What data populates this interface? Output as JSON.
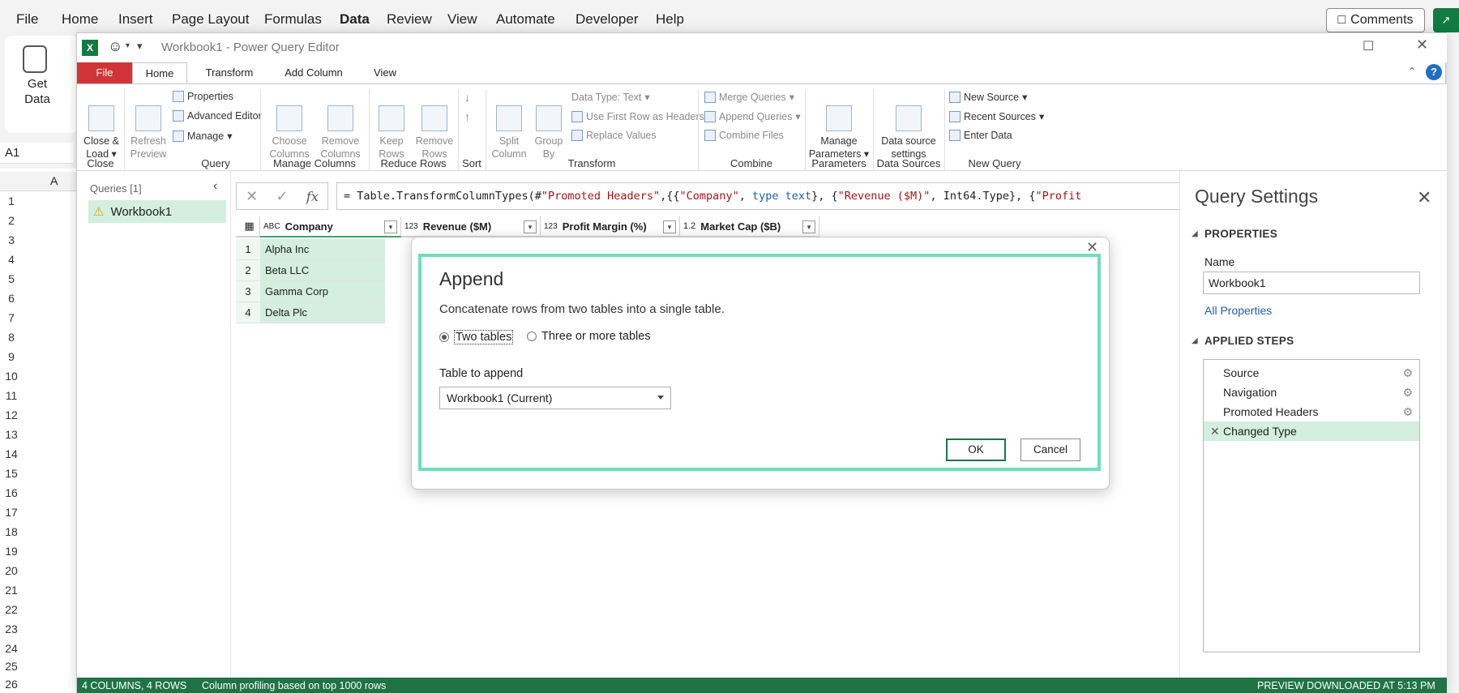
{
  "excel": {
    "menu": [
      "File",
      "Home",
      "Insert",
      "Page Layout",
      "Formulas",
      "Data",
      "Review",
      "View",
      "Automate",
      "Developer",
      "Help"
    ],
    "comments_label": "Comments",
    "get_data_label": "Get\nData",
    "namebox": "A1",
    "col_a": "A",
    "rows": [
      "1",
      "2",
      "3",
      "4",
      "5",
      "6",
      "7",
      "8",
      "9",
      "10",
      "11",
      "12",
      "13",
      "14",
      "15",
      "16",
      "17",
      "18",
      "19",
      "20",
      "21",
      "22",
      "23",
      "24",
      "25",
      "26"
    ]
  },
  "pq": {
    "title": "Workbook1 - Power Query Editor",
    "tabs": [
      "File",
      "Home",
      "Transform",
      "Add Column",
      "View"
    ],
    "ribbon": {
      "close_load": "Close &\nLoad",
      "refresh_preview": "Refresh\nPreview",
      "properties": "Properties",
      "advanced_editor": "Advanced Editor",
      "manage": "Manage",
      "choose_columns": "Choose\nColumns",
      "remove_columns": "Remove\nColumns",
      "keep_rows": "Keep\nRows",
      "remove_rows": "Remove\nRows",
      "split_column": "Split\nColumn",
      "group_by": "Group\nBy",
      "data_type": "Data Type: Text",
      "use_first_row": "Use First Row as Headers",
      "replace_values": "Replace Values",
      "merge_queries": "Merge Queries",
      "append_queries": "Append Queries",
      "combine_files": "Combine Files",
      "manage_parameters": "Manage\nParameters",
      "data_source_settings": "Data source\nsettings",
      "new_source": "New Source",
      "recent_sources": "Recent Sources",
      "enter_data": "Enter Data",
      "groups": [
        "Close",
        "Query",
        "Manage Columns",
        "Reduce Rows",
        "Sort",
        "Transform",
        "Combine",
        "Parameters",
        "Data Sources",
        "New Query"
      ]
    },
    "queries": {
      "header": "Queries [1]",
      "items": [
        "Workbook1"
      ]
    },
    "formula": {
      "prefix": "= Table.TransformColumnTypes(#",
      "s1": "\"Promoted Headers\"",
      "mid1": ",{{",
      "s2": "\"Company\"",
      "mid2": ", ",
      "k1": "type text",
      "mid3": "}, {",
      "s3": "\"Revenue ($M)\"",
      "mid4": ", Int64.Type}, {",
      "s4": "\"Profit"
    },
    "grid": {
      "columns": [
        {
          "type": "ABC",
          "name": "Company"
        },
        {
          "type": "123",
          "name": "Revenue ($M)"
        },
        {
          "type": "123",
          "name": "Profit Margin (%)"
        },
        {
          "type": "1.2",
          "name": "Market Cap ($B)"
        }
      ],
      "rows": [
        {
          "n": "1",
          "company": "Alpha Inc"
        },
        {
          "n": "2",
          "company": "Beta LLC"
        },
        {
          "n": "3",
          "company": "Gamma Corp"
        },
        {
          "n": "4",
          "company": "Delta Plc"
        }
      ]
    },
    "settings": {
      "title": "Query Settings",
      "properties_header": "PROPERTIES",
      "name_label": "Name",
      "name_value": "Workbook1",
      "all_properties": "All Properties",
      "applied_steps_header": "APPLIED STEPS",
      "steps": [
        "Source",
        "Navigation",
        "Promoted Headers",
        "Changed Type"
      ]
    },
    "status": {
      "left": "4 COLUMNS, 4 ROWS",
      "profiling": "Column profiling based on top 1000 rows",
      "right": "PREVIEW DOWNLOADED AT 5:13 PM"
    }
  },
  "dialog": {
    "title": "Append",
    "description": "Concatenate rows from two tables into a single table.",
    "option_two": "Two tables",
    "option_three": "Three or more tables",
    "table_label": "Table to append",
    "table_value": "Workbook1 (Current)",
    "ok": "OK",
    "cancel": "Cancel"
  },
  "colors": {
    "excel_green": "#217346",
    "file_tab_red": "#d13438",
    "highlight_mint": "#6fdfb9",
    "selected_green": "#d4eee0"
  }
}
